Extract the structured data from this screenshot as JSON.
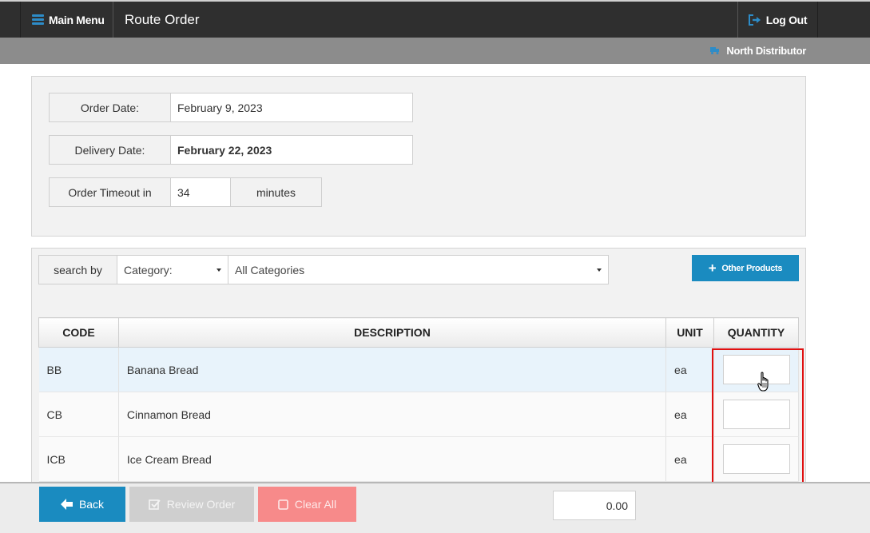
{
  "header": {
    "menu_label": "Main Menu",
    "title": "Route Order",
    "logout_label": "Log Out",
    "accent_color": "#2d8cc8"
  },
  "subheader": {
    "distributor": "North Distributor"
  },
  "order_info": {
    "order_date_label": "Order Date:",
    "order_date_value": "February 9, 2023",
    "delivery_date_label": "Delivery Date:",
    "delivery_date_value": "February 22, 2023",
    "timeout_label": "Order Timeout in",
    "timeout_value": "34",
    "timeout_unit": "minutes"
  },
  "search": {
    "label": "search by",
    "filter_type": "Category:",
    "filter_value": "All Categories",
    "other_products_label": "Other Products"
  },
  "table": {
    "columns": [
      "CODE",
      "DESCRIPTION",
      "UNIT",
      "QUANTITY"
    ],
    "rows": [
      {
        "code": "BB",
        "description": "Banana Bread",
        "unit": "ea",
        "quantity": ""
      },
      {
        "code": "CB",
        "description": "Cinnamon Bread",
        "unit": "ea",
        "quantity": ""
      },
      {
        "code": "ICB",
        "description": "Ice Cream Bread",
        "unit": "ea",
        "quantity": ""
      }
    ]
  },
  "footer": {
    "back_label": "Back",
    "review_label": "Review Order",
    "clear_label": "Clear All",
    "total_value": "0.00"
  },
  "icons": {
    "menu": "hamburger-icon",
    "logout": "sign-out-icon",
    "distributor": "truck-icon",
    "plus": "plus-icon",
    "back": "arrow-left-icon",
    "review": "check-square-icon",
    "clear": "square-icon",
    "cursor": "hand-pointer-icon"
  }
}
